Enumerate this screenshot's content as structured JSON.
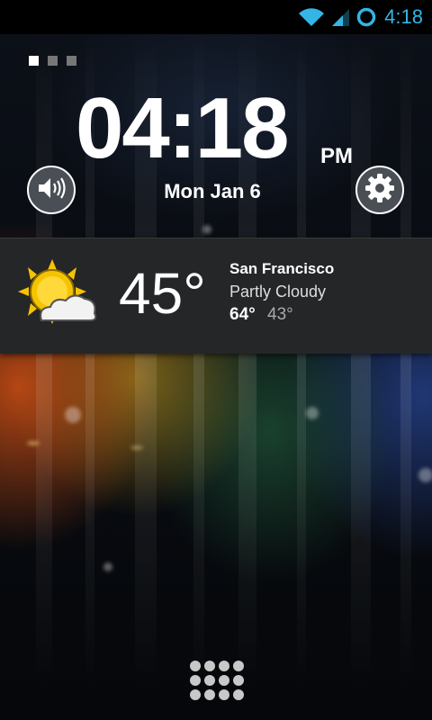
{
  "status_bar": {
    "time": "4:18",
    "accent_color": "#33b5e5",
    "icons": [
      "wifi-icon",
      "signal-icon",
      "sync-ring-icon"
    ]
  },
  "home_pages": {
    "count": 3,
    "active_index": 0
  },
  "clock": {
    "time": "04:18",
    "ampm": "PM",
    "date": "Mon Jan 6"
  },
  "buttons": {
    "left_icon": "speaker-volume-icon",
    "right_icon": "gear-icon"
  },
  "weather": {
    "icon": "sun-cloud-icon",
    "temperature": "45°",
    "city": "San Francisco",
    "condition": "Partly Cloudy",
    "high": "64°",
    "low": "43°"
  },
  "dock": {
    "app_drawer_icon": "app-grid-icon"
  }
}
